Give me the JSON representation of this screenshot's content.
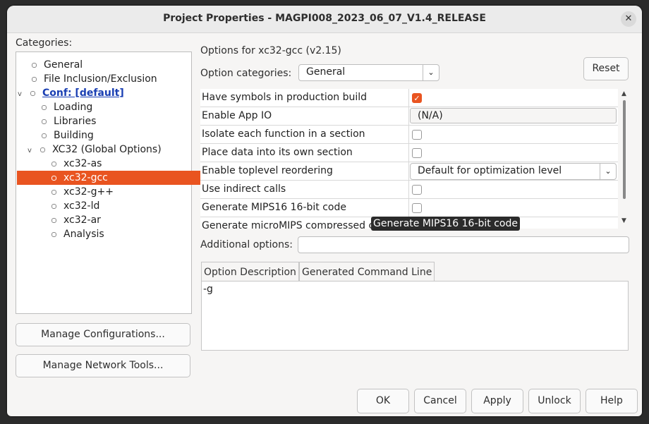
{
  "window": {
    "title": "Project Properties - MAGPI008_2023_06_07_V1.4_RELEASE",
    "close_glyph": "✕"
  },
  "categories_label": "Categories:",
  "tree": [
    {
      "label": "General",
      "indent": 0,
      "expander": ""
    },
    {
      "label": "File Inclusion/Exclusion",
      "indent": 0,
      "expander": ""
    },
    {
      "label": "Conf: [default]",
      "indent": 0,
      "expander": "v"
    },
    {
      "label": "Loading",
      "indent": 1,
      "expander": ""
    },
    {
      "label": "Libraries",
      "indent": 1,
      "expander": ""
    },
    {
      "label": "Building",
      "indent": 1,
      "expander": ""
    },
    {
      "label": "XC32 (Global Options)",
      "indent": 1,
      "expander": "v"
    },
    {
      "label": "xc32-as",
      "indent": 2,
      "expander": ""
    },
    {
      "label": "xc32-gcc",
      "indent": 2,
      "expander": "",
      "selected": true
    },
    {
      "label": "xc32-g++",
      "indent": 2,
      "expander": ""
    },
    {
      "label": "xc32-ld",
      "indent": 2,
      "expander": ""
    },
    {
      "label": "xc32-ar",
      "indent": 2,
      "expander": ""
    },
    {
      "label": "Analysis",
      "indent": 2,
      "expander": ""
    }
  ],
  "buttons": {
    "manage_configurations": "Manage Configurations...",
    "manage_network_tools": "Manage Network Tools...",
    "reset": "Reset",
    "ok": "OK",
    "cancel": "Cancel",
    "apply": "Apply",
    "unlock": "Unlock",
    "help": "Help"
  },
  "options_for": "Options for xc32-gcc (v2.15)",
  "option_categories_label": "Option categories:",
  "option_category_value": "General",
  "options": [
    {
      "name": "Have symbols in production build",
      "type": "checkbox",
      "checked": true
    },
    {
      "name": "Enable App IO",
      "type": "text",
      "value": "(N/A)"
    },
    {
      "name": "Isolate each function in a section",
      "type": "checkbox",
      "checked": false
    },
    {
      "name": "Place data into its own section",
      "type": "checkbox",
      "checked": false
    },
    {
      "name": "Enable toplevel reordering",
      "type": "combo",
      "value": "Default for optimization level"
    },
    {
      "name": "Use indirect calls",
      "type": "checkbox",
      "checked": false
    },
    {
      "name": "Generate MIPS16 16-bit code",
      "type": "checkbox",
      "checked": false
    },
    {
      "name": "Generate microMIPS compressed c",
      "type": "checkbox",
      "checked": false
    }
  ],
  "tooltip": "Generate MIPS16 16-bit code",
  "additional_options_label": "Additional options:",
  "additional_options_value": "",
  "tabs": [
    "Option Description",
    "Generated Command Line"
  ],
  "command_line": "-g",
  "accent_color": "#e95420"
}
